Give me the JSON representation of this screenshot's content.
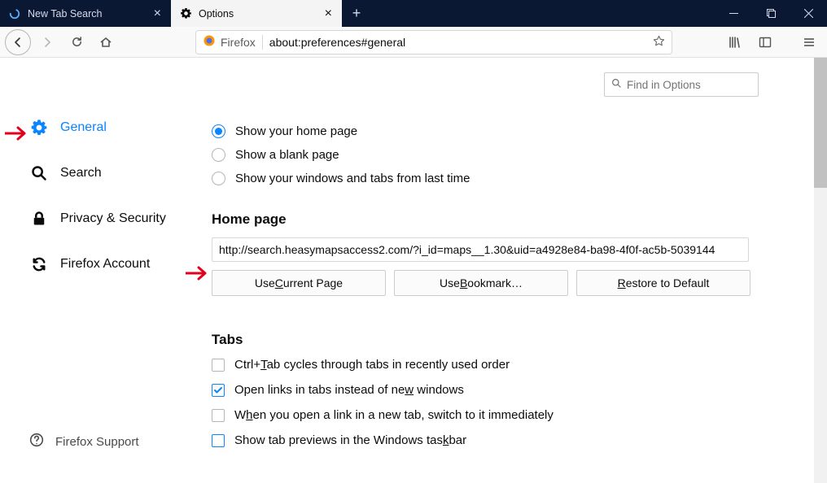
{
  "tabs": [
    {
      "label": "New Tab Search",
      "active": false
    },
    {
      "label": "Options",
      "active": true
    }
  ],
  "urlbar": {
    "identity": "Firefox",
    "url": "about:preferences#general"
  },
  "sidebar": {
    "items": [
      {
        "label": "General"
      },
      {
        "label": "Search"
      },
      {
        "label": "Privacy & Security"
      },
      {
        "label": "Firefox Account"
      }
    ],
    "support": "Firefox Support"
  },
  "search": {
    "placeholder": "Find in Options"
  },
  "startup": {
    "radios": [
      {
        "label": "Show your home page",
        "checked": true
      },
      {
        "label": "Show a blank page",
        "checked": false
      },
      {
        "label": "Show your windows and tabs from last time",
        "checked": false
      }
    ]
  },
  "homepage": {
    "heading": "Home page",
    "value": "http://search.heasymapsaccess2.com/?i_id=maps__1.30&uid=a4928e84-ba98-4f0f-ac5b-5039144",
    "buttons": {
      "use_current": "Use Current Page",
      "use_bookmark": "Use Bookmark…",
      "restore": "Restore to Default"
    }
  },
  "tabs_section": {
    "heading": "Tabs",
    "items": [
      {
        "label_html": "Ctrl+<u>T</u>ab cycles through tabs in recently used order",
        "checked": false
      },
      {
        "label_html": "Open links in tabs instead of ne<u>w</u> windows",
        "checked": true
      },
      {
        "label_html": "W<u>h</u>en you open a link in a new tab, switch to it immediately",
        "checked": false
      },
      {
        "label_html": "Show tab previews in the Windows tas<u>k</u>bar",
        "checked": false,
        "highlighted": true
      }
    ]
  }
}
